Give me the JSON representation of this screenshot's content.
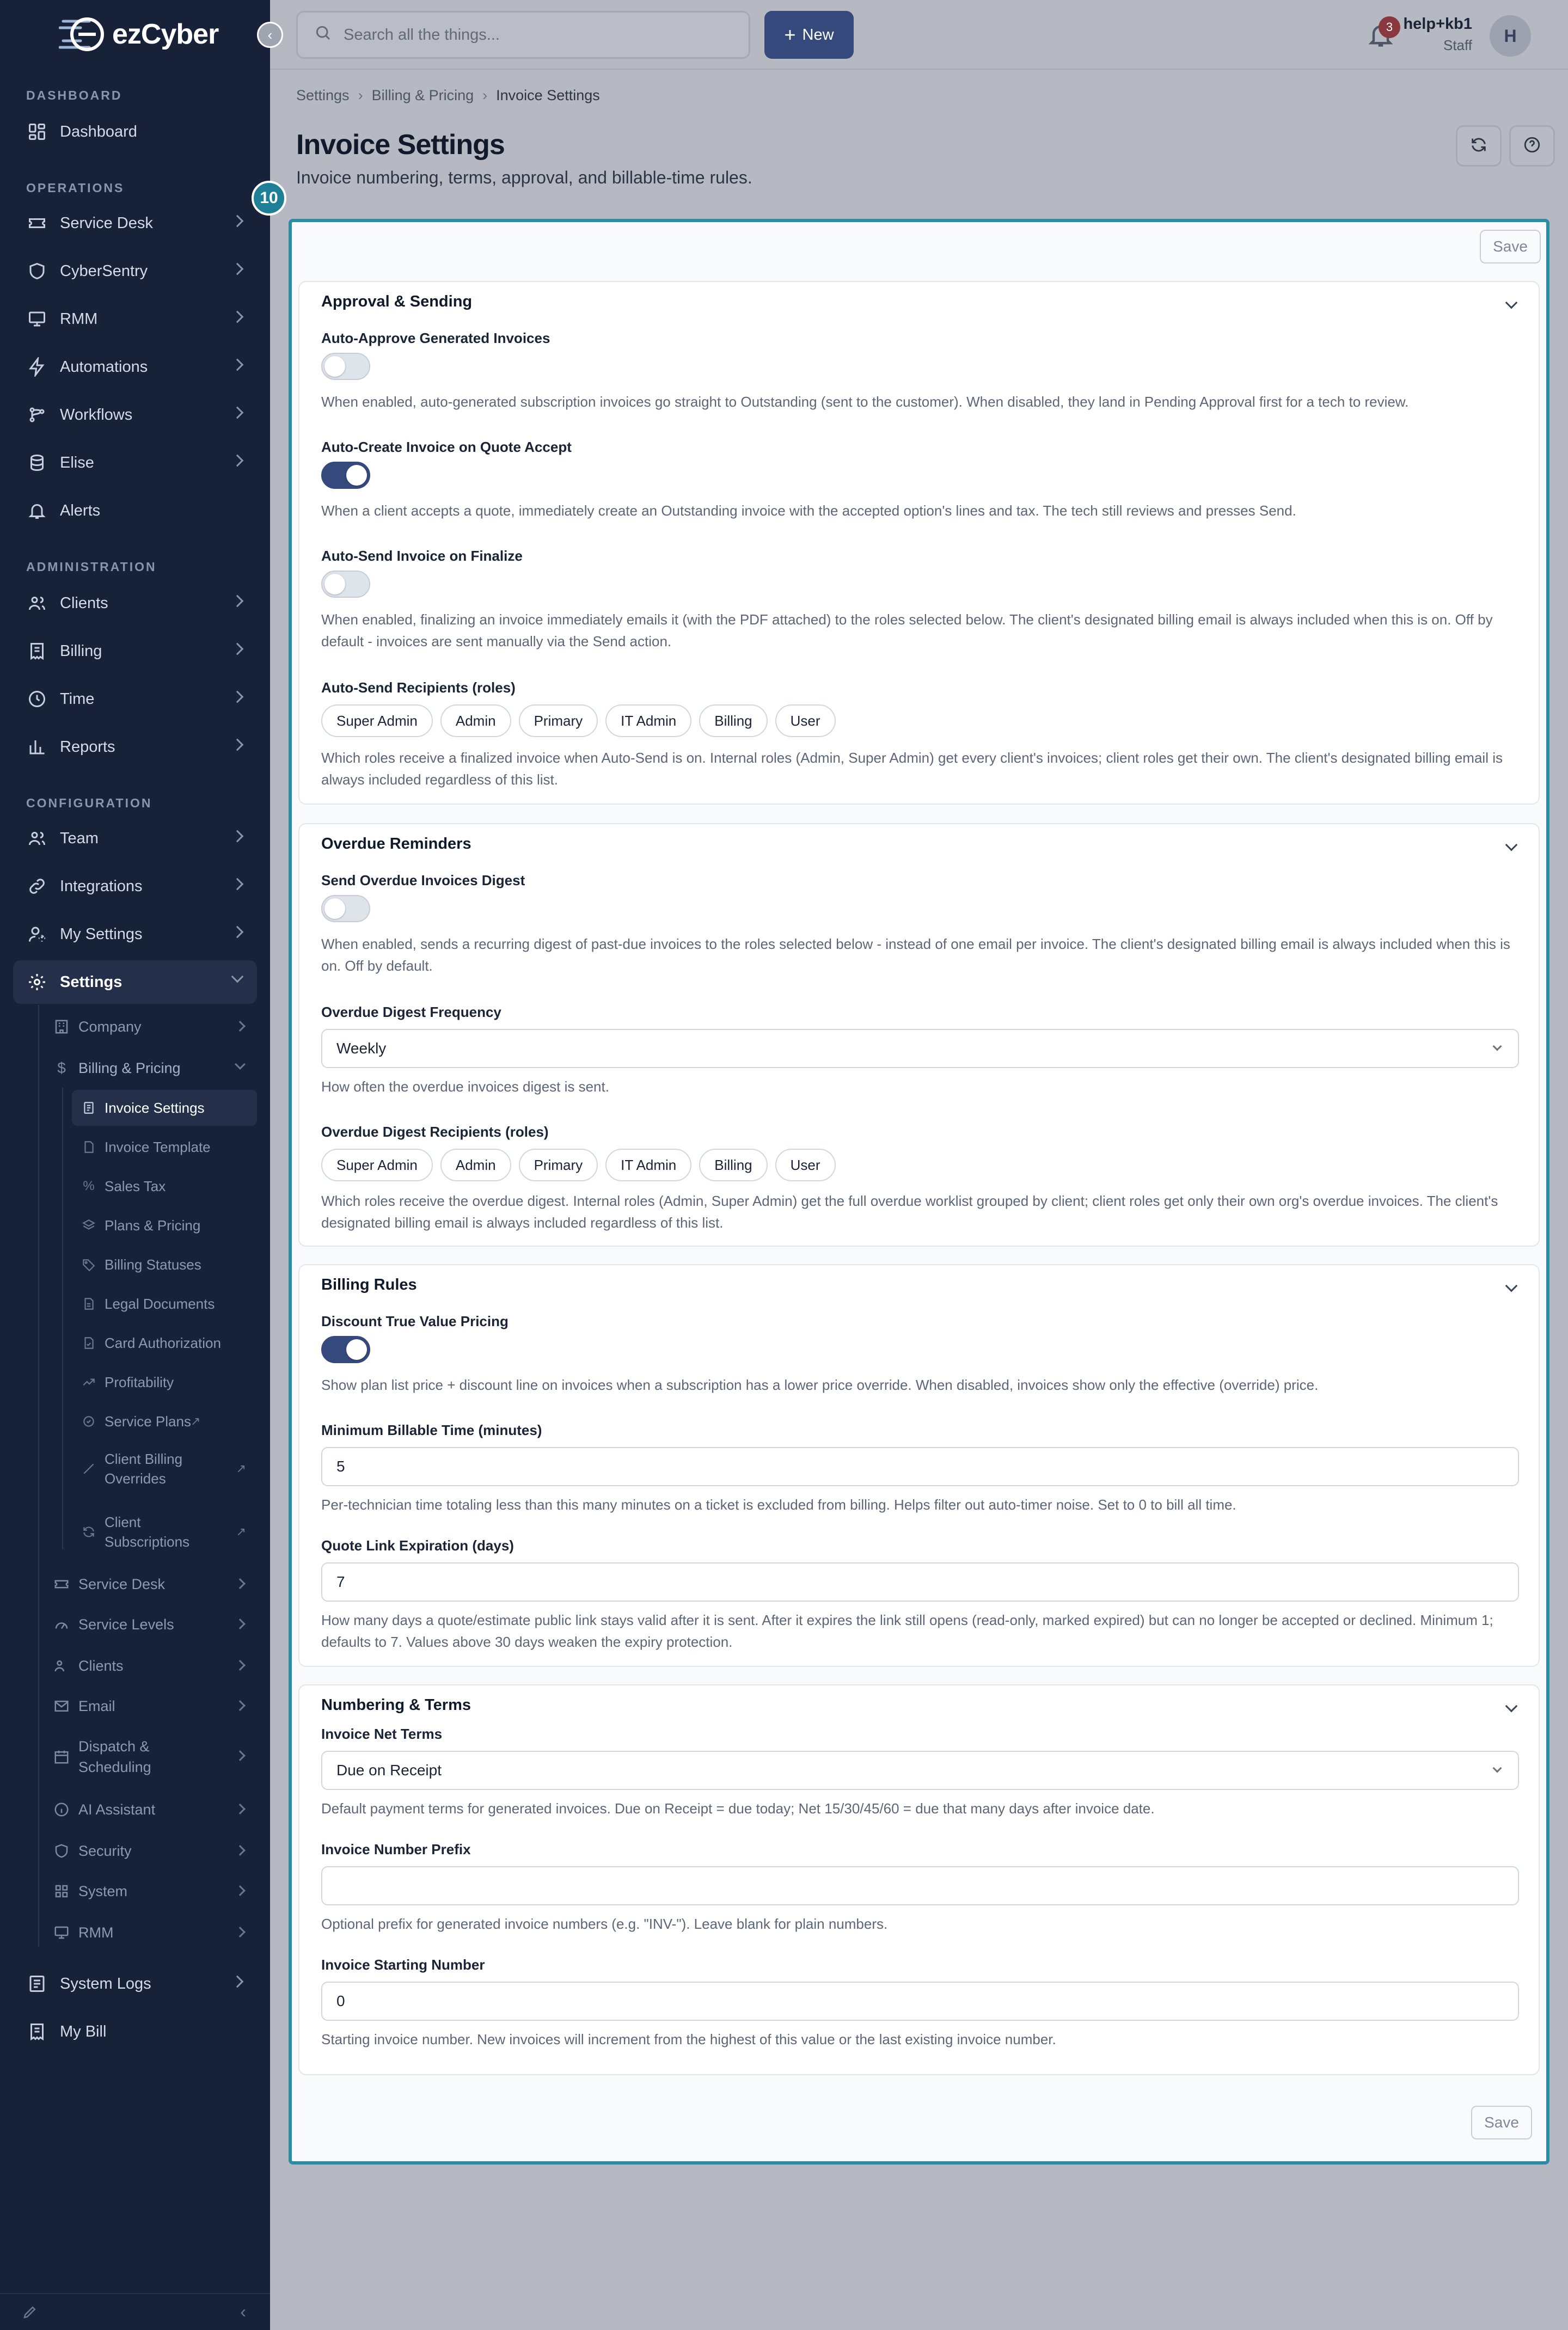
{
  "app": {
    "logo_text": "ezCyber"
  },
  "sidebar": {
    "sections": {
      "dashboard": "DASHBOARD",
      "operations": "OPERATIONS",
      "administration": "ADMINISTRATION",
      "configuration": "CONFIGURATION"
    },
    "items": {
      "dashboard": "Dashboard",
      "service_desk": "Service Desk",
      "cybersentry": "CyberSentry",
      "rmm": "RMM",
      "automations": "Automations",
      "workflows": "Workflows",
      "elise": "Elise",
      "alerts": "Alerts",
      "clients": "Clients",
      "billing": "Billing",
      "time": "Time",
      "reports": "Reports",
      "team": "Team",
      "integrations": "Integrations",
      "my_settings": "My Settings",
      "settings": "Settings",
      "system_logs": "System Logs",
      "my_bill": "My Bill"
    },
    "settings_sub": {
      "company": "Company",
      "billing_pricing": "Billing & Pricing",
      "service_desk": "Service Desk",
      "service_levels": "Service Levels",
      "clients": "Clients",
      "email": "Email",
      "dispatch_line1": "Dispatch &",
      "dispatch_line2": "Scheduling",
      "ai_assistant": "AI Assistant",
      "security": "Security",
      "system": "System",
      "rmm": "RMM"
    },
    "billing_sub": {
      "invoice_settings": "Invoice Settings",
      "invoice_template": "Invoice Template",
      "sales_tax": "Sales Tax",
      "plans_pricing": "Plans & Pricing",
      "billing_statuses": "Billing Statuses",
      "legal_documents": "Legal Documents",
      "card_authorization": "Card Authorization",
      "profitability": "Profitability",
      "service_plans": "Service Plans",
      "client_billing_line1": "Client Billing",
      "client_billing_line2": "Overrides",
      "client_subs_line1": "Client",
      "client_subs_line2": "Subscriptions"
    }
  },
  "topbar": {
    "search_placeholder": "Search all the things...",
    "new_label": "New",
    "notification_count": "3",
    "user_name": "help+kb1",
    "user_role": "Staff",
    "avatar_initial": "H"
  },
  "page": {
    "breadcrumb": [
      "Settings",
      "Billing & Pricing",
      "Invoice Settings"
    ],
    "title": "Invoice Settings",
    "subtitle": "Invoice numbering, terms, approval, and billable-time rules.",
    "step_badge": "10",
    "save_label": "Save"
  },
  "roles": [
    "Super Admin",
    "Admin",
    "Primary",
    "IT Admin",
    "Billing",
    "User"
  ],
  "approval": {
    "title": "Approval & Sending",
    "auto_approve_label": "Auto-Approve Generated Invoices",
    "auto_approve_on": false,
    "auto_approve_help": "When enabled, auto-generated subscription invoices go straight to Outstanding (sent to the customer). When disabled, they land in Pending Approval first for a tech to review.",
    "auto_create_label": "Auto-Create Invoice on Quote Accept",
    "auto_create_on": true,
    "auto_create_help": "When a client accepts a quote, immediately create an Outstanding invoice with the accepted option's lines and tax. The tech still reviews and presses Send.",
    "auto_send_label": "Auto-Send Invoice on Finalize",
    "auto_send_on": false,
    "auto_send_help": "When enabled, finalizing an invoice immediately emails it (with the PDF attached) to the roles selected below. The client's designated billing email is always included when this is on. Off by default - invoices are sent manually via the Send action.",
    "recipients_label": "Auto-Send Recipients (roles)",
    "recipients_help": "Which roles receive a finalized invoice when Auto-Send is on. Internal roles (Admin, Super Admin) get every client's invoices; client roles get their own. The client's designated billing email is always included regardless of this list."
  },
  "overdue": {
    "title": "Overdue Reminders",
    "digest_label": "Send Overdue Invoices Digest",
    "digest_on": false,
    "digest_help": "When enabled, sends a recurring digest of past-due invoices to the roles selected below - instead of one email per invoice. The client's designated billing email is always included when this is on. Off by default.",
    "frequency_label": "Overdue Digest Frequency",
    "frequency_value": "Weekly",
    "frequency_help": "How often the overdue invoices digest is sent.",
    "recipients_label": "Overdue Digest Recipients (roles)",
    "recipients_help": "Which roles receive the overdue digest. Internal roles (Admin, Super Admin) get the full overdue worklist grouped by client; client roles get only their own org's overdue invoices. The client's designated billing email is always included regardless of this list."
  },
  "billing_rules": {
    "title": "Billing Rules",
    "discount_label": "Discount True Value Pricing",
    "discount_on": true,
    "discount_help": "Show plan list price + discount line on invoices when a subscription has a lower price override. When disabled, invoices show only the effective (override) price.",
    "min_time_label": "Minimum Billable Time (minutes)",
    "min_time_value": "5",
    "min_time_help": "Per-technician time totaling less than this many minutes on a ticket is excluded from billing. Helps filter out auto-timer noise. Set to 0 to bill all time.",
    "quote_exp_label": "Quote Link Expiration (days)",
    "quote_exp_value": "7",
    "quote_exp_help": "How many days a quote/estimate public link stays valid after it is sent. After it expires the link still opens (read-only, marked expired) but can no longer be accepted or declined. Minimum 1; defaults to 7. Values above 30 days weaken the expiry protection."
  },
  "numbering": {
    "title": "Numbering & Terms",
    "net_terms_label": "Invoice Net Terms",
    "net_terms_value": "Due on Receipt",
    "net_terms_help": "Default payment terms for generated invoices. Due on Receipt = due today; Net 15/30/45/60 = due that many days after invoice date.",
    "prefix_label": "Invoice Number Prefix",
    "prefix_value": "",
    "prefix_help": "Optional prefix for generated invoice numbers (e.g. \"INV-\"). Leave blank for plain numbers.",
    "start_label": "Invoice Starting Number",
    "start_value": "0",
    "start_help": "Starting invoice number. New invoices will increment from the highest of this value or the last existing invoice number."
  }
}
